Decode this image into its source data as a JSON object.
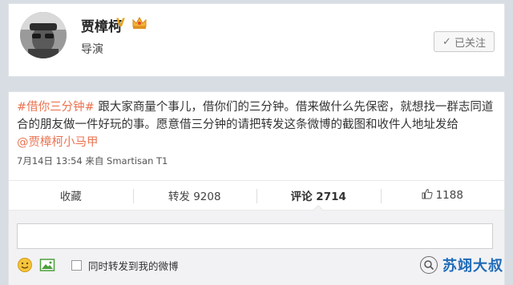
{
  "profile": {
    "name": "贾樟柯",
    "verified_mark": "V",
    "subtitle": "导演",
    "follow_label": "已关注",
    "follow_icon": "check-icon"
  },
  "post": {
    "hashtag": "#借你三分钟#",
    "body": "跟大家商量个事儿，借你们的三分钟。借来做什么先保密，就想找一群志同道合的朋友做一件好玩的事。愿意借三分钟的请把转发这条微博的截图和收件人地址发给",
    "mention": "@贾樟柯小马甲",
    "meta": "7月14日 13:54 来自 Smartisan T1"
  },
  "actions": {
    "collect": "收藏",
    "repost": "转发 9208",
    "comment": "评论 2714",
    "like": "1188",
    "like_icon": "thumbs-up-icon"
  },
  "composer": {
    "placeholder": "",
    "also_repost_label": "同时转发到我的微博",
    "emoji_icon": "smiley-icon",
    "image_icon": "image-icon"
  },
  "watermark": {
    "text": "苏翊大叔",
    "icon": "wechat-search-icon"
  },
  "colors": {
    "accent": "#eb7350",
    "background": "#d8dde3",
    "watermark": "#1e6bb8"
  }
}
